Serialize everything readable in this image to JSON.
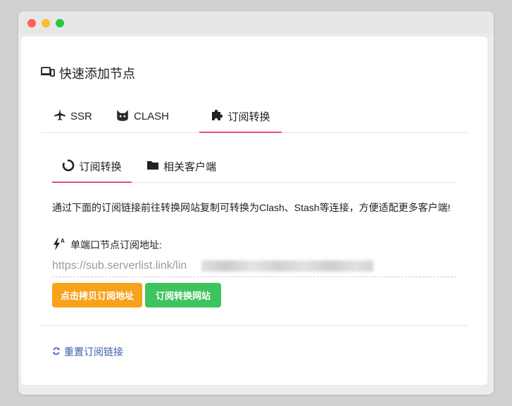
{
  "window": {
    "controls": [
      "close",
      "minimize",
      "maximize"
    ]
  },
  "card": {
    "title": "快速添加节点",
    "title_icon": "devices-icon"
  },
  "primary_tabs": [
    {
      "label": "SSR",
      "icon": "plane-icon",
      "active": false
    },
    {
      "label": "CLASH",
      "icon": "cat-icon",
      "active": false
    },
    {
      "label": "订阅转换",
      "icon": "puzzle-icon",
      "active": true
    }
  ],
  "secondary_tabs": [
    {
      "label": "订阅转换",
      "icon": "circle-notch-icon",
      "active": true
    },
    {
      "label": "相关客户端",
      "icon": "folder-icon",
      "active": false
    }
  ],
  "content": {
    "description": "通过下面的订阅链接前往转换网站复制可转换为Clash、Stash等连接，方便适配更多客户端!",
    "url_label": "单端口节点订阅地址:",
    "url_value": "https://sub.serverlist.link/lin",
    "copy_button": "点击拷贝订阅地址",
    "convert_button": "订阅转换网站",
    "reset_link": "重置订阅链接"
  },
  "colors": {
    "active_tab": "#e8488a",
    "copy_button": "#f7a21b",
    "convert_button": "#3ec45d",
    "link": "#3a5ea8"
  }
}
